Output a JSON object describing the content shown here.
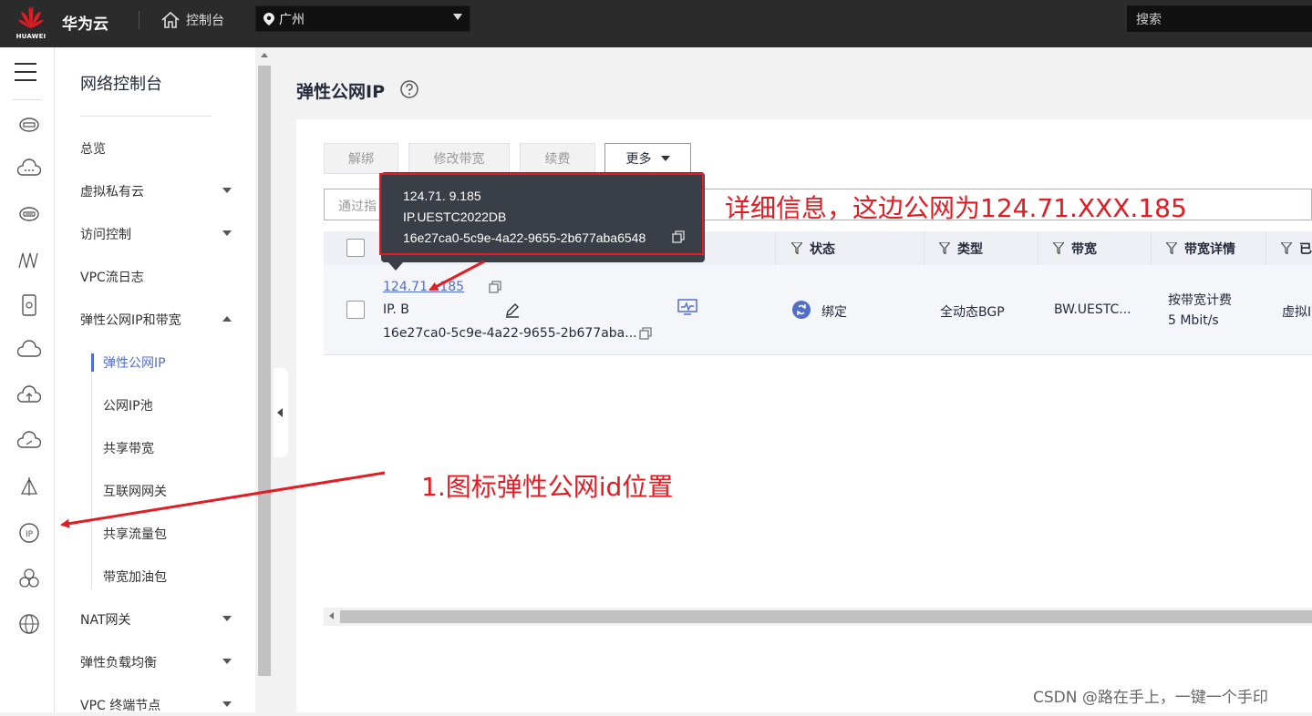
{
  "topbar": {
    "logo_text": "HUAWEI",
    "brand": "华为云",
    "console_label": "控制台",
    "region": "广州",
    "search_placeholder": "搜索"
  },
  "sidenav": {
    "title": "网络控制台",
    "items": [
      {
        "label": "总览"
      },
      {
        "label": "虚拟私有云"
      },
      {
        "label": "访问控制"
      },
      {
        "label": "VPC流日志"
      },
      {
        "label": "弹性公网IP和带宽"
      },
      {
        "label": "NAT网关"
      },
      {
        "label": "弹性负载均衡"
      },
      {
        "label": "VPC 终端节点"
      }
    ],
    "subitems": [
      {
        "label": "弹性公网IP"
      },
      {
        "label": "公网IP池"
      },
      {
        "label": "共享带宽"
      },
      {
        "label": "互联网网关"
      },
      {
        "label": "共享流量包"
      },
      {
        "label": "带宽加油包"
      }
    ]
  },
  "main": {
    "title": "弹性公网IP",
    "toolbar": {
      "unbind": "解绑",
      "modify_bandwidth": "修改带宽",
      "renew": "续费",
      "more": "更多"
    },
    "filter_placeholder": "通过指",
    "table": {
      "headers": {
        "status": "状态",
        "type": "类型",
        "bandwidth": "带宽",
        "bandwidth_detail": "带宽详情",
        "last": "已"
      },
      "row": {
        "ip": "124.71.     .185",
        "name": "IP.           B",
        "id": "16e27ca0-5c9e-4a22-9655-2b677aba...",
        "status": "绑定",
        "type": "全动态BGP",
        "bandwidth": "BW.UESTC...",
        "billing": "按带宽计费",
        "speed": "5 Mbit/s",
        "last": "虚拟I"
      }
    },
    "tooltip": {
      "ip": "124.71.    9.185",
      "name": "IP.UESTC2022DB",
      "id": "16e27ca0-5c9e-4a22-9655-2b677aba6548"
    }
  },
  "annotations": {
    "detail": "详细信息，这边公网为124.71.XXX.185",
    "icon": "1.图标弹性公网id位置"
  },
  "watermark": "CSDN @路在手上，一键一个手印",
  "colors": {
    "accent": "#526ecc",
    "annotation": "#e31b23",
    "topbar": "#2b2b2b"
  }
}
